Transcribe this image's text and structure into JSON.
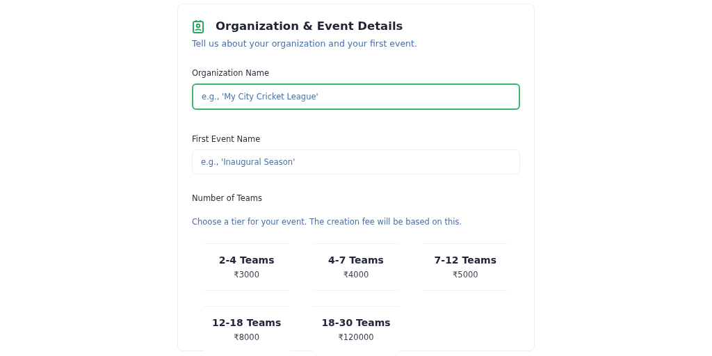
{
  "card": {
    "title": "Organization & Event Details",
    "subtitle": "Tell us about your organization and your first event."
  },
  "fields": [
    {
      "label": "Organization Name",
      "placeholder": "e.g., 'My City Cricket League'",
      "focused": true
    },
    {
      "label": "First Event Name",
      "placeholder": "e.g., 'Inaugural Season'",
      "focused": false
    }
  ],
  "teams": {
    "label": "Number of Teams",
    "hint": "Choose a tier for your event. The creation fee will be based on this.",
    "tiers": [
      {
        "name": "2-4 Teams",
        "price": "₹3000"
      },
      {
        "name": "4-7 Teams",
        "price": "₹4000"
      },
      {
        "name": "7-12 Teams",
        "price": "₹5000"
      },
      {
        "name": "12-18 Teams",
        "price": "₹8000"
      },
      {
        "name": "18-30 Teams",
        "price": "₹120000"
      }
    ]
  }
}
